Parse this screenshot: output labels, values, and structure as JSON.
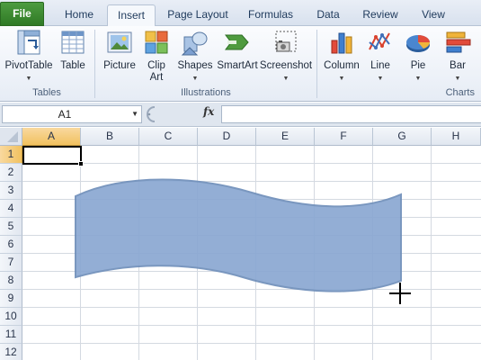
{
  "ribbon_tabs": [
    {
      "label": "File"
    },
    {
      "label": "Home"
    },
    {
      "label": "Insert"
    },
    {
      "label": "Page Layout"
    },
    {
      "label": "Formulas"
    },
    {
      "label": "Data"
    },
    {
      "label": "Review"
    },
    {
      "label": "View"
    }
  ],
  "active_tab": "Insert",
  "groups": {
    "tables": {
      "label": "Tables",
      "buttons": [
        {
          "label": "PivotTable",
          "icon": "pivottable-icon",
          "has_dropdown": true
        },
        {
          "label": "Table",
          "icon": "table-icon"
        }
      ]
    },
    "illustrations": {
      "label": "Illustrations",
      "buttons": [
        {
          "label": "Picture",
          "icon": "picture-icon"
        },
        {
          "label": "Clip\nArt",
          "label_line1": "Clip",
          "label_line2": "Art",
          "icon": "clip-art-icon"
        },
        {
          "label": "Shapes",
          "icon": "shapes-icon",
          "has_dropdown": true
        },
        {
          "label": "SmartArt",
          "icon": "smartart-icon"
        },
        {
          "label": "Screenshot",
          "icon": "screenshot-icon",
          "has_dropdown": true
        }
      ]
    },
    "charts": {
      "label": "Charts",
      "buttons": [
        {
          "label": "Column",
          "icon": "column-chart-icon",
          "has_dropdown": true
        },
        {
          "label": "Line",
          "icon": "line-chart-icon",
          "has_dropdown": true
        },
        {
          "label": "Pie",
          "icon": "pie-chart-icon",
          "has_dropdown": true
        },
        {
          "label": "Bar",
          "icon": "bar-chart-icon",
          "has_dropdown": true
        }
      ]
    }
  },
  "formula_bar": {
    "name_box": "A1",
    "fx_label": "fx",
    "formula": ""
  },
  "columns": [
    "A",
    "B",
    "C",
    "D",
    "E",
    "F",
    "G",
    "H"
  ],
  "rows": [
    "1",
    "2",
    "3",
    "4",
    "5",
    "6",
    "7",
    "8",
    "9",
    "10",
    "11",
    "12"
  ],
  "selected_cell": {
    "column": "A",
    "row": "1"
  },
  "shape": {
    "type": "wave",
    "fill": "#8aa8d2",
    "stroke": "#6f8fba"
  },
  "colors": {
    "file_tab": "#3a8a2f",
    "selection_header": "#f5cd73",
    "ribbon_text": "#1e395b"
  }
}
